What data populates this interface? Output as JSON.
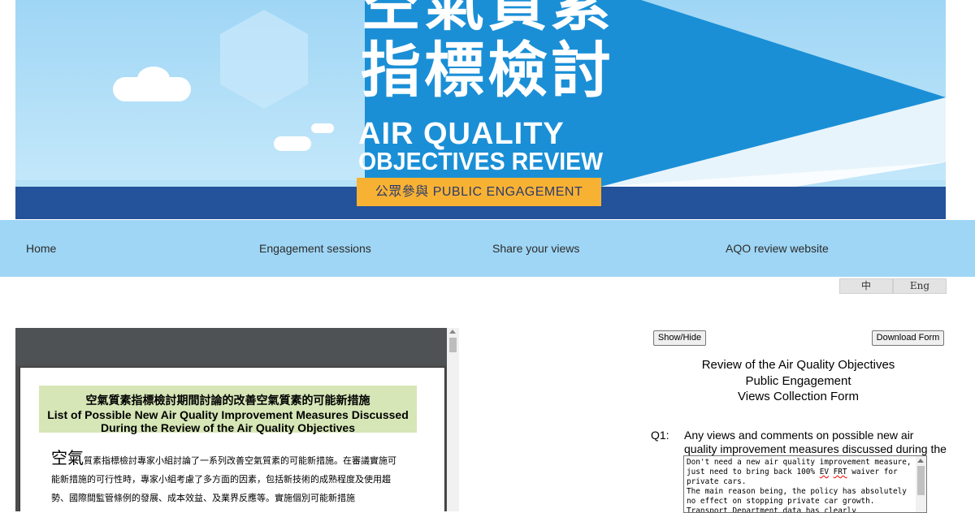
{
  "banner": {
    "title_zh_line1": "空氣質素",
    "title_zh_line2": "指標檢討",
    "title_en_line1": "AIR QUALITY",
    "title_en_line2": "OBJECTIVES REVIEW",
    "engagement_label": "公眾參與 PUBLIC ENGAGEMENT",
    "colors": {
      "sky": "#9fd6f5",
      "wedge": "#1a8fd6",
      "navy": "#24529b",
      "badge": "#f8b233"
    }
  },
  "nav": {
    "items": [
      {
        "label": "Home"
      },
      {
        "label": "Engagement sessions"
      },
      {
        "label": "Share your views"
      },
      {
        "label": "AQO review website"
      }
    ]
  },
  "lang": {
    "zh": "中",
    "en": "Eng"
  },
  "pdf": {
    "heading_zh": "空氣質素指標檢討期間討論的改善空氣質素的可能新措施",
    "heading_en_line1": "List of Possible New Air Quality Improvement Measures Discussed",
    "heading_en_line2": "During the Review of the Air Quality Objectives",
    "para_lead": "空氣",
    "para_rest": "質素指標檢討專家小組討論了一系列改善空氣質素的可能新措施。在審議實施可能新措施的可行性時，專家小組考慮了多方面的因素，包括新技術的成熟程度及使用趨勢、國際間監管條例的發展、成本效益、及業界反應等。實施個別可能新措施"
  },
  "form": {
    "show_hide_label": "Show/Hide",
    "download_label": "Download Form",
    "title_line1": "Review of the Air Quality Objectives",
    "title_line2": "Public Engagement",
    "title_line3": "Views Collection Form",
    "q1_label": "Q1:",
    "q1_text": "Any views and comments on possible new air quality improvement measures discussed during the review?",
    "q1_answer_part1": "Don't need a new air quality improvement measure, just need to bring back 100% ",
    "q1_answer_ev": "EV",
    "q1_answer_frt": "FRT",
    "q1_answer_part2": "waiver for private cars.\nThe main reason being, the policy has absolutely no effect on stopping private car growth. Transport Department data has clearly"
  }
}
